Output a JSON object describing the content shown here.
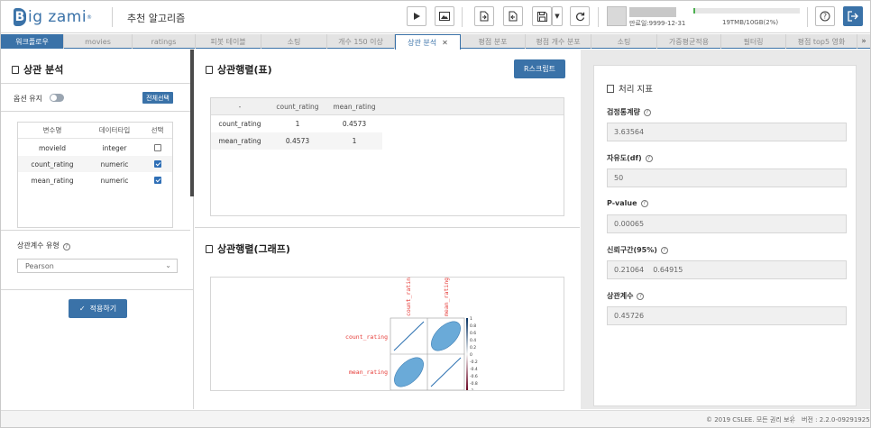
{
  "header": {
    "logo_letter": "B",
    "logo_text": "ig zami",
    "logo_reg": "®",
    "app_title": "추천 알고리즘",
    "user_expire": "만료일:9999-12-31",
    "storage_text": "19TMB/10GB(2%)",
    "storage_fraction": 0.02,
    "icons": [
      "play-icon",
      "image-icon",
      "import-icon",
      "export-icon",
      "save-icon",
      "refresh-icon",
      "help-icon",
      "logout-icon"
    ]
  },
  "tabs": [
    {
      "label": "워크플로우"
    },
    {
      "label": "movies"
    },
    {
      "label": "ratings"
    },
    {
      "label": "피봇 테이블"
    },
    {
      "label": "소팅"
    },
    {
      "label": "개수 150 이상"
    },
    {
      "label": "상관 분석"
    },
    {
      "label": "평점 분포"
    },
    {
      "label": "평점 개수 분포"
    },
    {
      "label": "소팅"
    },
    {
      "label": "가중평균적용"
    },
    {
      "label": "필터링"
    },
    {
      "label": "평점 top5 영화"
    }
  ],
  "tab_more": "»",
  "left": {
    "title": "상관 분석",
    "option_label": "옵션 유지",
    "select_all": "전체선택",
    "table": {
      "headers": [
        "변수명",
        "데이터타입",
        "선택"
      ],
      "rows": [
        {
          "name": "movieId",
          "type": "integer",
          "checked": false
        },
        {
          "name": "count_rating",
          "type": "numeric",
          "checked": true
        },
        {
          "name": "mean_rating",
          "type": "numeric",
          "checked": true
        }
      ]
    },
    "corr_type_label": "상관계수 유형",
    "corr_type_value": "Pearson",
    "apply_label": "적용하기"
  },
  "middle": {
    "table_title": "상관행렬(표)",
    "rscript_label": "R스크립트",
    "matrix": {
      "headers": [
        "-",
        "count_rating",
        "mean_rating"
      ],
      "rows": [
        [
          "count_rating",
          "1",
          "0.4573"
        ],
        [
          "mean_rating",
          "0.4573",
          "1"
        ]
      ]
    },
    "graph_title": "상관행렬(그래프)",
    "graph": {
      "vars": [
        "count_rating",
        "mean_rating"
      ],
      "scale_ticks": [
        "1",
        "0.8",
        "0.6",
        "0.4",
        "0.2",
        "0",
        "-0.2",
        "-0.4",
        "-0.6",
        "-0.8",
        "-1"
      ],
      "label_color": "#e53935",
      "ellipse_color": "#6aaad8"
    }
  },
  "right": {
    "title": "처리 지표",
    "stats": [
      {
        "label": "검정통계량",
        "value": "3.63564"
      },
      {
        "label": "자유도(df)",
        "value": "50"
      },
      {
        "label": "P-value",
        "value": "0.00065"
      },
      {
        "label": "신뢰구간(95%)",
        "value": "0.21064    0.64915"
      },
      {
        "label": "상관계수",
        "value": "0.45726"
      }
    ]
  },
  "footer": {
    "copyright": "© 2019 CSLEE. 모든 권리 보유",
    "version": "버전 : 2.2.0-09291925"
  },
  "colors": {
    "accent": "#3a72a8",
    "storage_fill": "#4caf50"
  }
}
